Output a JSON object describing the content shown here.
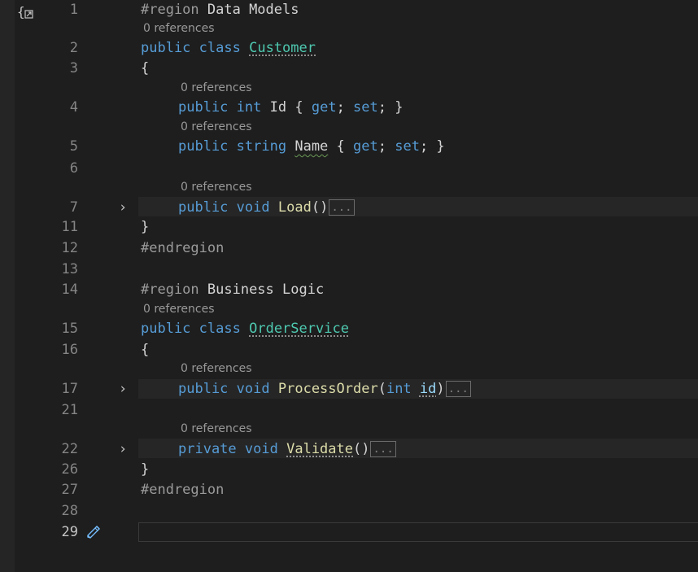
{
  "editor": {
    "lens_text": "0 references",
    "collapsed_text": "...",
    "lines": [
      {
        "n": "1",
        "text": ""
      },
      {
        "n": "2",
        "text": ""
      },
      {
        "n": "3",
        "text": "{"
      },
      {
        "n": "4",
        "text": ""
      },
      {
        "n": "5",
        "text": ""
      },
      {
        "n": "6",
        "text": ""
      },
      {
        "n": "7",
        "text": ""
      },
      {
        "n": "11",
        "text": "}"
      },
      {
        "n": "12",
        "text": "#endregion"
      },
      {
        "n": "13",
        "text": ""
      },
      {
        "n": "14",
        "text": ""
      },
      {
        "n": "15",
        "text": ""
      },
      {
        "n": "16",
        "text": "{"
      },
      {
        "n": "17",
        "text": ""
      },
      {
        "n": "21",
        "text": ""
      },
      {
        "n": "22",
        "text": ""
      },
      {
        "n": "26",
        "text": "}"
      },
      {
        "n": "27",
        "text": "#endregion"
      },
      {
        "n": "28",
        "text": ""
      },
      {
        "n": "29",
        "text": ""
      }
    ],
    "tokens": {
      "region": "#region",
      "data_models": " Data Models",
      "business_logic": " Business Logic",
      "public": "public",
      "private": "private",
      "class": "class",
      "int": "int",
      "string": "string",
      "void": "void",
      "get": "get",
      "set": "set",
      "customer": "Customer",
      "order_service": "OrderService",
      "id_prop": "Id",
      "name_prop": "Name",
      "load": "Load",
      "process_order": "ProcessOrder",
      "validate": "Validate",
      "id_param": "id"
    }
  }
}
